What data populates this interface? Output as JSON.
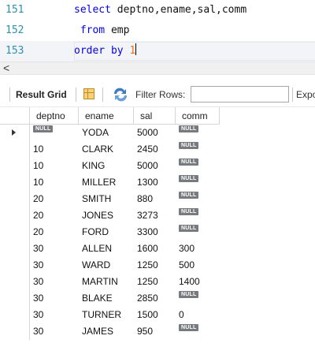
{
  "editor": {
    "lines": [
      {
        "number": "151",
        "parts": [
          {
            "text": "select ",
            "kind": "kw"
          },
          {
            "text": "deptno,ename,sal,comm",
            "kind": "plain"
          }
        ]
      },
      {
        "number": "152",
        "parts": [
          {
            "text": " from ",
            "kind": "kw"
          },
          {
            "text": "emp",
            "kind": "plain"
          }
        ]
      },
      {
        "number": "153",
        "parts": [
          {
            "text": "order by ",
            "kind": "kw"
          },
          {
            "text": "1",
            "kind": "num"
          }
        ]
      }
    ]
  },
  "scrollbar": {
    "left_arrow": "<"
  },
  "toolbar": {
    "result_grid_label": "Result Grid",
    "filter_label": "Filter Rows:",
    "filter_value": "",
    "export_label": "Export:"
  },
  "grid": {
    "columns": [
      "deptno",
      "ename",
      "sal",
      "comm"
    ],
    "null_label": "NULL",
    "rows": [
      {
        "deptno": null,
        "ename": "YODA",
        "sal": "5000",
        "comm": null
      },
      {
        "deptno": "10",
        "ename": "CLARK",
        "sal": "2450",
        "comm": null
      },
      {
        "deptno": "10",
        "ename": "KING",
        "sal": "5000",
        "comm": null
      },
      {
        "deptno": "10",
        "ename": "MILLER",
        "sal": "1300",
        "comm": null
      },
      {
        "deptno": "20",
        "ename": "SMITH",
        "sal": "880",
        "comm": null
      },
      {
        "deptno": "20",
        "ename": "JONES",
        "sal": "3273",
        "comm": null
      },
      {
        "deptno": "20",
        "ename": "FORD",
        "sal": "3300",
        "comm": null
      },
      {
        "deptno": "30",
        "ename": "ALLEN",
        "sal": "1600",
        "comm": "300"
      },
      {
        "deptno": "30",
        "ename": "WARD",
        "sal": "1250",
        "comm": "500"
      },
      {
        "deptno": "30",
        "ename": "MARTIN",
        "sal": "1250",
        "comm": "1400"
      },
      {
        "deptno": "30",
        "ename": "BLAKE",
        "sal": "2850",
        "comm": null
      },
      {
        "deptno": "30",
        "ename": "TURNER",
        "sal": "1500",
        "comm": "0"
      },
      {
        "deptno": "30",
        "ename": "JAMES",
        "sal": "950",
        "comm": null
      }
    ],
    "selected_row": 0
  },
  "colors": {
    "keyword": "#0000ff",
    "number": "#ff6a00",
    "line_number": "#2b91af",
    "null_badge": "#777b7f"
  }
}
